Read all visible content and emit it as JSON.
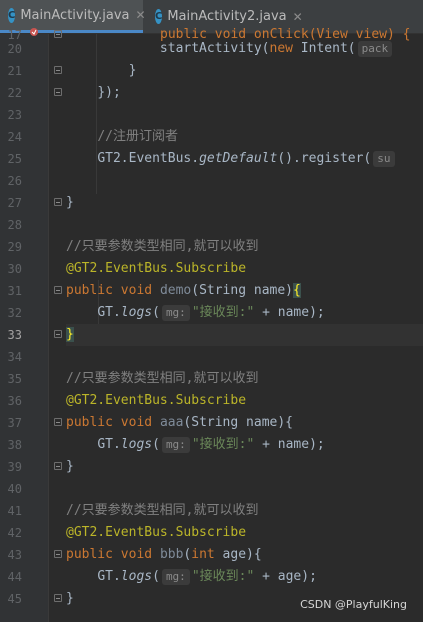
{
  "tabs": [
    {
      "label": "MainActivity.java",
      "active": true
    },
    {
      "label": "MainActivity2.java",
      "active": false
    }
  ],
  "line_numbers": [
    "17",
    "20",
    "21",
    "22",
    "23",
    "24",
    "25",
    "26",
    "27",
    "28",
    "29",
    "30",
    "31",
    "32",
    "33",
    "34",
    "35",
    "36",
    "37",
    "38",
    "39",
    "40",
    "41",
    "42",
    "43",
    "44",
    "45"
  ],
  "code": {
    "l17": {
      "text": "public void onClick(View view) {"
    },
    "l20": {
      "t1": "startActivity(",
      "kw": "new",
      "t2": " Intent(",
      "hint": "pack"
    },
    "l21": {
      "text": "}"
    },
    "l22": {
      "text": "});"
    },
    "l24": {
      "text": "//注册订阅者"
    },
    "l25": {
      "t1": "GT2.EventBus.",
      "m": "getDefault",
      "t2": "().register(",
      "hint": "su"
    },
    "l27": {
      "text": "}"
    },
    "b1": {
      "comment": "//只要参数类型相同,就可以收到",
      "ann_prefix": "@GT2.EventBus.",
      "ann_name": "Subscribe",
      "kw1": "public",
      "kw2": "void",
      "name": "demo",
      "params": "(String name)",
      "open": "{",
      "call_a": "GT.",
      "call_m": "logs",
      "call_b": "(",
      "hint": "mg:",
      "str": "\"接收到:\"",
      "call_c": " + name);",
      "close": "}"
    },
    "b2": {
      "comment": "//只要参数类型相同,就可以收到",
      "ann_prefix": "@GT2.EventBus.",
      "ann_name": "Subscribe",
      "kw1": "public",
      "kw2": "void",
      "name": "aaa",
      "params": "(String name){",
      "call_a": "GT.",
      "call_m": "logs",
      "call_b": "(",
      "hint": "mg:",
      "str": "\"接收到:\"",
      "call_c": " + name);",
      "close": "}"
    },
    "b3": {
      "comment": "//只要参数类型相同,就可以收到",
      "ann_prefix": "@GT2.EventBus.",
      "ann_name": "Subscribe",
      "kw1": "public",
      "kw2": "void",
      "name": "bbb",
      "p_open": "(",
      "p_kw": "int",
      "p_rest": " age){",
      "call_a": "GT.",
      "call_m": "logs",
      "call_b": "(",
      "hint": "mg:",
      "str": "\"接收到:\"",
      "call_c": " + age);",
      "close": "}"
    }
  },
  "watermark": "CSDN @PlayfulKing",
  "colors": {
    "background": "#2b2b2b",
    "keyword": "#cc7832",
    "method": "#ffc66d",
    "annotation": "#bbb529",
    "string": "#6a8759",
    "comment": "#808080"
  }
}
